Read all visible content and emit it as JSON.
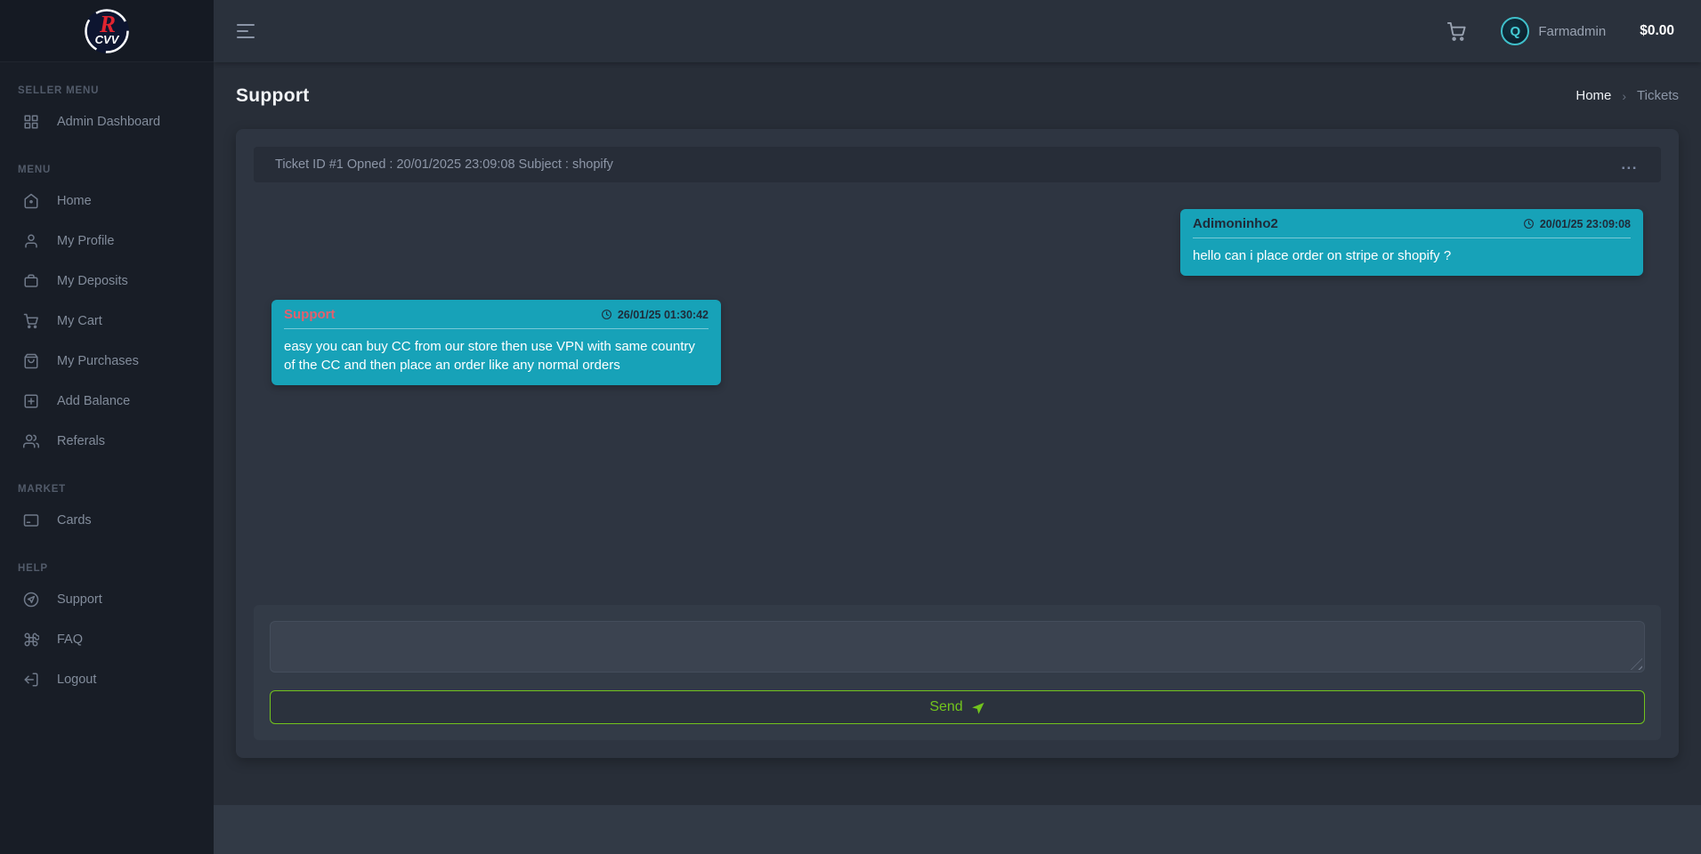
{
  "colors": {
    "accent_teal": "#17a2b8",
    "send_green": "#72c41d",
    "support_name_red": "#e4606d",
    "sidebar_bg": "#181d26",
    "card_bg": "#2e3541"
  },
  "brand": {
    "logo_initial": "R",
    "logo_name": "CVV"
  },
  "topbar": {
    "cart_icon": "shopping-cart-icon",
    "avatar_letter": "Q",
    "username": "Farmadmin",
    "balance": "$0.00"
  },
  "page": {
    "title": "Support",
    "breadcrumb": {
      "home": "Home",
      "separator": "›",
      "current": "Tickets"
    }
  },
  "sidebar": {
    "sections": [
      {
        "label": "SELLER MENU",
        "items": [
          {
            "label": "Admin Dashboard",
            "icon": "dashboard-icon"
          }
        ]
      },
      {
        "label": "MENU",
        "items": [
          {
            "label": "Home",
            "icon": "home-icon"
          },
          {
            "label": "My Profile",
            "icon": "user-icon"
          },
          {
            "label": "My Deposits",
            "icon": "briefcase-icon"
          },
          {
            "label": "My Cart",
            "icon": "cart-icon"
          },
          {
            "label": "My Purchases",
            "icon": "shopping-bag-icon"
          },
          {
            "label": "Add Balance",
            "icon": "plus-square-icon"
          },
          {
            "label": "Referals",
            "icon": "users-icon"
          }
        ]
      },
      {
        "label": "MARKET",
        "items": [
          {
            "label": "Cards",
            "icon": "credit-card-icon"
          }
        ]
      },
      {
        "label": "HELP",
        "items": [
          {
            "label": "Support",
            "icon": "send-circle-icon"
          },
          {
            "label": "FAQ",
            "icon": "command-icon"
          },
          {
            "label": "Logout",
            "icon": "logout-icon"
          }
        ]
      }
    ]
  },
  "ticket": {
    "header": "Ticket ID #1 Opned : 20/01/2025 23:09:08 Subject : shopify",
    "menu_dots": "..."
  },
  "messages": [
    {
      "author": "Adimoninho2",
      "time": "20/01/25 23:09:08",
      "text": "hello can i place order on stripe or shopify ?"
    },
    {
      "author": "Support",
      "time": "26/01/25 01:30:42",
      "text": "easy you can buy CC from our store then use VPN with same country of the CC and then place an order like any normal orders"
    }
  ],
  "reply": {
    "send_label": "Send"
  }
}
